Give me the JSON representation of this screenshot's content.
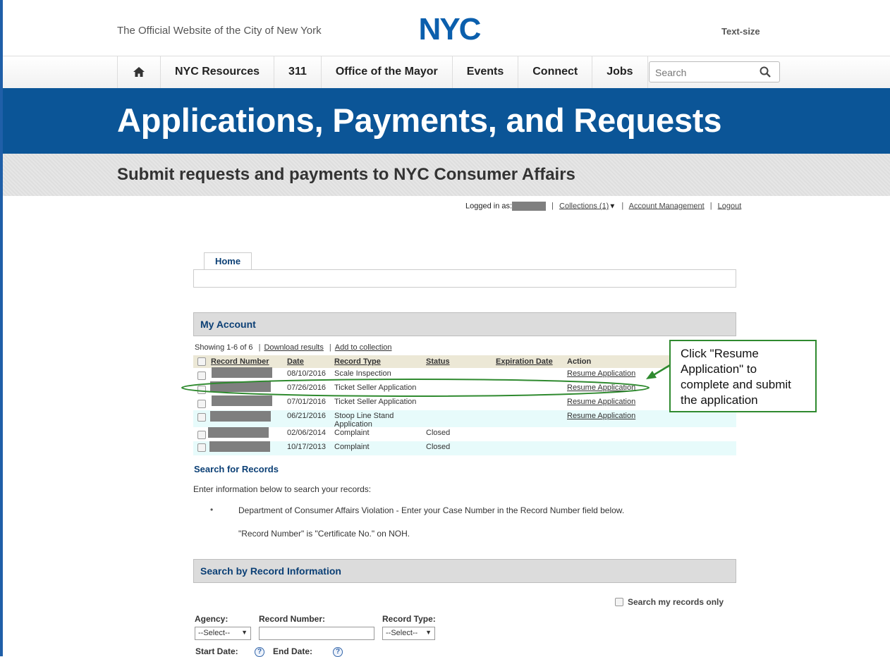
{
  "header": {
    "tagline": "The Official Website of the City of New York",
    "logo_text": "NYC",
    "text_size": "Text-size"
  },
  "nav": {
    "home_icon": "home-icon",
    "items": [
      "NYC Resources",
      "311",
      "Office of the Mayor",
      "Events",
      "Connect",
      "Jobs"
    ],
    "search_placeholder": "Search",
    "search_icon": "search-icon"
  },
  "banner": {
    "title": "Applications, Payments, and Requests",
    "subtitle": "Submit requests and payments to NYC Consumer Affairs"
  },
  "login_bar": {
    "logged_in_label": "Logged in as:",
    "collections": "Collections (1)",
    "account_management": "Account Management",
    "logout": "Logout"
  },
  "tabs": {
    "home": "Home"
  },
  "my_account": {
    "title": "My Account",
    "showing": "Showing 1-6 of 6",
    "download": "Download results",
    "add_collection": "Add to collection",
    "columns": [
      "Record Number",
      "Date",
      "Record Type",
      "Status",
      "Expiration Date",
      "Action"
    ],
    "rows": [
      {
        "date": "08/10/2016",
        "type": "Scale Inspection",
        "status": "",
        "action": "Resume Application"
      },
      {
        "date": "07/26/2016",
        "type": "Ticket Seller Application",
        "status": "",
        "action": "Resume Application"
      },
      {
        "date": "07/01/2016",
        "type": "Ticket Seller Application",
        "status": "",
        "action": "Resume Application"
      },
      {
        "date": "06/21/2016",
        "type": "Stoop Line Stand Application",
        "status": "",
        "action": "Resume Application"
      },
      {
        "date": "02/06/2014",
        "type": "Complaint",
        "status": "Closed",
        "action": ""
      },
      {
        "date": "10/17/2013",
        "type": "Complaint",
        "status": "Closed",
        "action": ""
      }
    ]
  },
  "callout": {
    "text": "Click \"Resume Application\" to complete and submit the application",
    "color": "#2f8a2f"
  },
  "search_records": {
    "title": "Search for Records",
    "intro": "Enter information below to search your records:",
    "bullet": "Department of Consumer Affairs Violation - Enter your Case Number in the Record Number field below.",
    "note": "\"Record Number\" is \"Certificate No.\" on NOH."
  },
  "search_by_record": {
    "title": "Search by Record Information",
    "my_records_only": "Search my records only",
    "agency_label": "Agency:",
    "agency_value": "--Select--",
    "record_number_label": "Record Number:",
    "record_type_label": "Record Type:",
    "record_type_value": "--Select--",
    "start_date_label": "Start Date:",
    "end_date_label": "End Date:",
    "help_glyph": "?"
  },
  "colors": {
    "brand_blue": "#0b5597",
    "link_navy": "#0b3f75",
    "row_alt": "#e7fbfb",
    "header_row": "#ece8d6"
  }
}
